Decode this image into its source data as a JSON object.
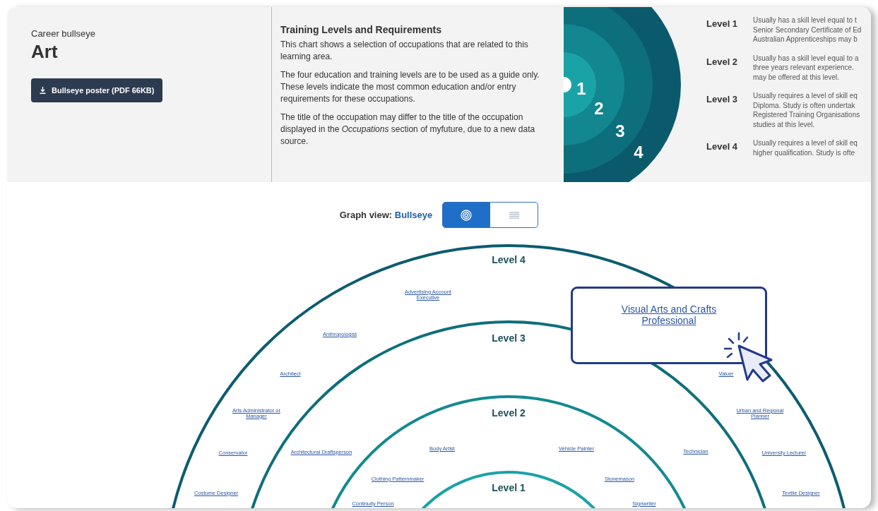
{
  "header": {
    "eyebrow": "Career bullseye",
    "title": "Art",
    "download_button": "Bullseye poster (PDF 66KB)"
  },
  "info": {
    "heading": "Training Levels and Requirements",
    "paragraphs": [
      "This chart shows a selection of occupations that are related to this learning area.",
      "The four education and training levels are to be used as a guide only. These levels indicate the most common education and/or entry requirements for these occupations.",
      "The title of the occupation may differ to the title of the occupation displayed in the *Occupations* section of myfuture, due to a new data source."
    ]
  },
  "legend_graphic": {
    "numbers": [
      "1",
      "2",
      "3",
      "4"
    ]
  },
  "levels": [
    {
      "label": "Level 1",
      "lines": [
        "Usually has a skill level equal to t",
        "Senior Secondary Certificate of Ed",
        "Australian Apprenticeships may b"
      ]
    },
    {
      "label": "Level 2",
      "lines": [
        "Usually has a skill level equal to a",
        "three years relevant experience.",
        "may be offered at this level."
      ]
    },
    {
      "label": "Level 3",
      "lines": [
        "Usually requires a level of skill eq",
        "Diploma. Study is often undertak",
        "Registered Training Organisations",
        "studies at this level."
      ]
    },
    {
      "label": "Level 4",
      "lines": [
        "Usually requires a level of skill eq",
        "higher qualification. Study is ofte"
      ]
    }
  ],
  "view_toggle": {
    "label": "Graph view:",
    "current": "Bullseye",
    "options": [
      {
        "kind": "bullseye",
        "selected": true
      },
      {
        "kind": "list",
        "selected": false
      }
    ]
  },
  "bullseye": {
    "rings": [
      {
        "label": "Level 4",
        "occupations": [
          "Advertising Account Executive",
          "Anthropologist",
          "Architect",
          "Arts Administrator or Manager",
          "Conservator",
          "Costume Designer",
          "Valuer",
          "Urban and Regional Planner",
          "University Lecturer",
          "Textile Designer"
        ]
      },
      {
        "label": "Level 3",
        "occupations": [
          "Architectural Draftsperson",
          "Technician"
        ]
      },
      {
        "label": "Level 2",
        "occupations": [
          "Body Artist",
          "Vehicle Painter",
          "Clothing Patternmaker",
          "Stonemason",
          "Continuity Person",
          "Signwriter"
        ]
      },
      {
        "label": "Level 1"
      }
    ]
  },
  "highlight": {
    "text": "Visual Arts and Crafts Professional"
  }
}
